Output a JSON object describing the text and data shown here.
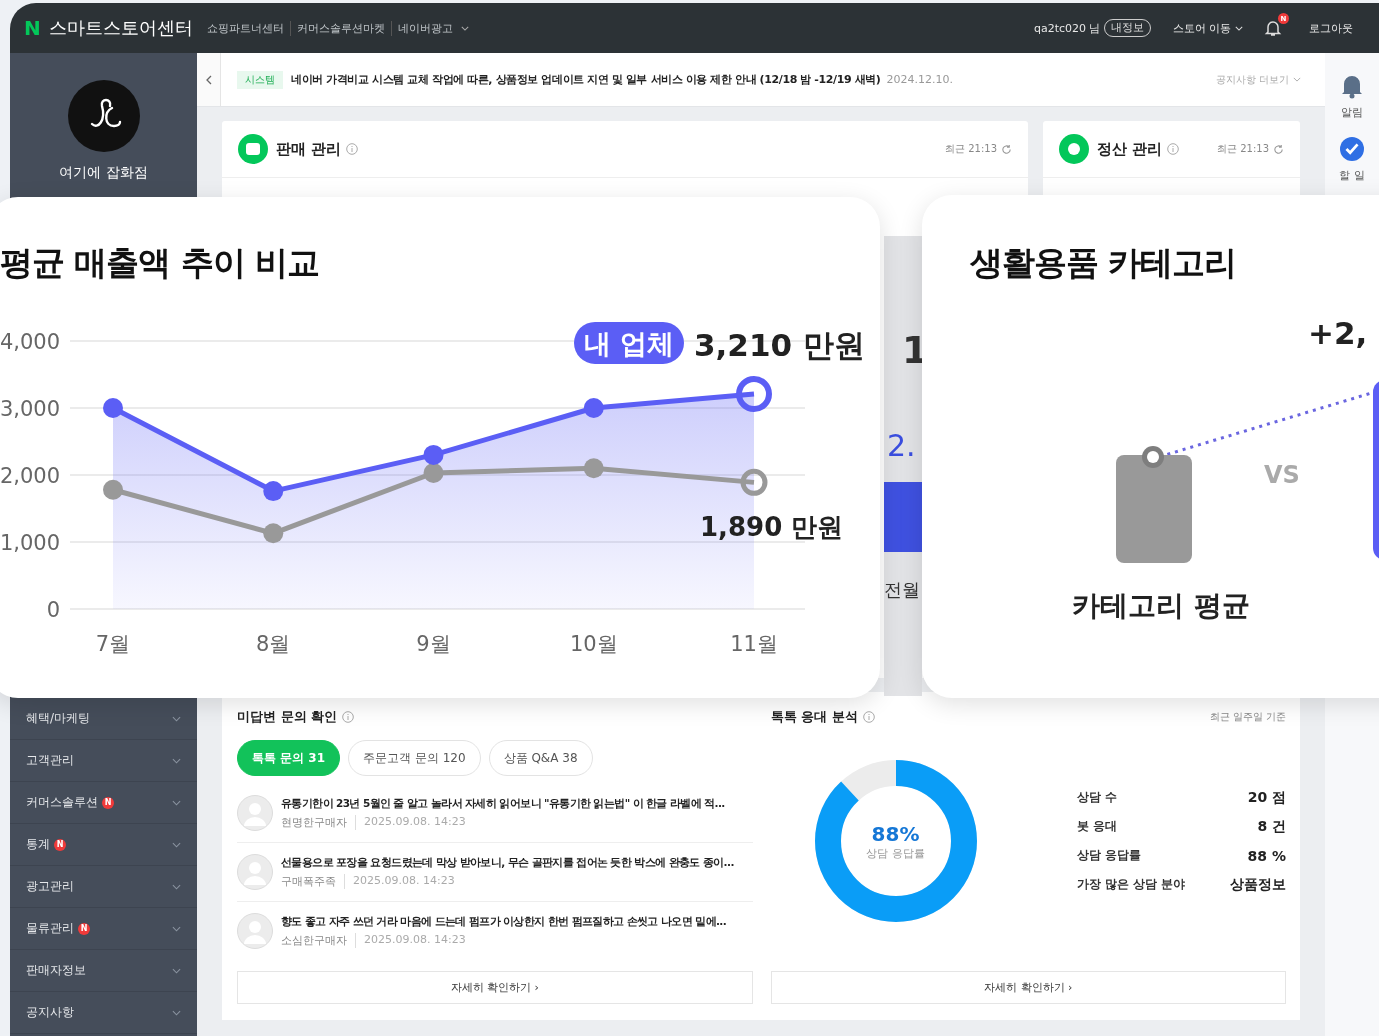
{
  "top_bar": {
    "logo_mark": "N",
    "brand": "스마트스토어센터",
    "links": [
      {
        "label": "쇼핑파트너센터",
        "dropdown": false
      },
      {
        "label": "커머스솔루션마켓",
        "dropdown": false
      },
      {
        "label": "네이버광고",
        "dropdown": true
      }
    ],
    "user": "qa2tc020 님",
    "profile_button": "내정보",
    "store_move": "스토어 이동",
    "notification_badge": "N",
    "logout": "로그아웃"
  },
  "sidebar": {
    "store_name": "여기에 잡화점",
    "menu": [
      {
        "label": "혜택/마케팅"
      },
      {
        "label": "고객관리"
      },
      {
        "label": "커머스솔루션",
        "badge": "N"
      },
      {
        "label": "통계",
        "badge": "N"
      },
      {
        "label": "광고관리"
      },
      {
        "label": "물류관리",
        "badge": "N"
      },
      {
        "label": "판매자정보"
      },
      {
        "label": "공지사항"
      }
    ]
  },
  "notice": {
    "tag": "시스템",
    "text": "네이버 가격비교 시스템 교체 작업에 따른, 상품정보 업데이트 지연 및 일부 서비스 이용 제한 안내 (12/18 밤 -12/19 새벽)",
    "date": "2024.12.10.",
    "more": "공지사항 더보기"
  },
  "cards": [
    {
      "kind": "sales",
      "title": "판매 관리",
      "updated": "최근 21:13"
    },
    {
      "kind": "settlement",
      "title": "정산 관리",
      "updated": "최근 21:13"
    }
  ],
  "rail": [
    {
      "kind": "bell",
      "label": "알림"
    },
    {
      "kind": "check",
      "label": "할 일"
    }
  ],
  "background_fragments": {
    "number": "1",
    "amount": "2.",
    "month": "전월"
  },
  "inquiries": {
    "title": "미답변 문의 확인",
    "tabs": [
      {
        "label": "톡톡 문의 31",
        "selected": true
      },
      {
        "label": "주문고객 문의 120",
        "selected": false
      },
      {
        "label": "상품 Q&A 38",
        "selected": false
      }
    ],
    "items": [
      {
        "text": "유통기한이 23년 5월인 줄 알고 놀라서 자세히 읽어보니 \"유통기한 읽는법\" 이 한글 라벨에 적...",
        "author": "현명한구매자",
        "date": "2025.09.08. 14:23"
      },
      {
        "text": "선물용으로 포장을 요청드렸는데 막상 받아보니, 무슨 골판지를 접어논 듯한 박스에 완충도 종이...",
        "author": "구매폭주족",
        "date": "2025.09.08. 14:23"
      },
      {
        "text": "향도 좋고 자주 쓰던 거라 마음에 드는데 펌프가 이상한지 한번 펌프질하고 손씻고 나오면 밑에...",
        "author": "소심한구매자",
        "date": "2025.09.08. 14:23"
      }
    ],
    "button": "자세히 확인하기 ›"
  },
  "talk_analysis": {
    "title": "톡톡 응대 분석",
    "period": "최근 일주일 기준",
    "donut": {
      "level": 0.88,
      "value": "88%",
      "label": "상담 응답률"
    },
    "stats": [
      {
        "label": "상담 수",
        "value": "20 점"
      },
      {
        "label": "봇 응대",
        "value": "8 건"
      },
      {
        "label": "상담 응답률",
        "value": "88 %"
      },
      {
        "label": "가장 많은 상담 분야",
        "value": "상품정보"
      }
    ],
    "button": "자세히 확인하기 ›"
  },
  "sales_chart_card": {
    "chart_data": {
      "type": "line",
      "title": "평균 매출액 추이 비교",
      "categories": [
        "7월",
        "8월",
        "9월",
        "10월",
        "11월"
      ],
      "series": [
        {
          "name": "내 업체",
          "color": "#5b5ef5",
          "marker": true,
          "values": [
            3000,
            1760,
            2300,
            3000,
            3210
          ]
        },
        {
          "color": "#999999",
          "marker": true,
          "values": [
            1780,
            1130,
            2030,
            2100,
            1890
          ]
        }
      ],
      "grid": true,
      "ylim": [
        0,
        4000
      ],
      "yticks": [
        {
          "value": 0,
          "label": "0"
        },
        {
          "value": 1000,
          "label": "1,000"
        },
        {
          "value": 2000,
          "label": "2,000"
        },
        {
          "value": 3000,
          "label": "3,000"
        },
        {
          "value": 4000,
          "label": "4,000"
        }
      ],
      "annotations": [
        "3,210 만원",
        "1,890 만원"
      ]
    }
  },
  "category_card": {
    "title": "생활용품 카테고리",
    "delta": "+2,",
    "vs": "VS",
    "average_label": "카테고리 평균"
  }
}
